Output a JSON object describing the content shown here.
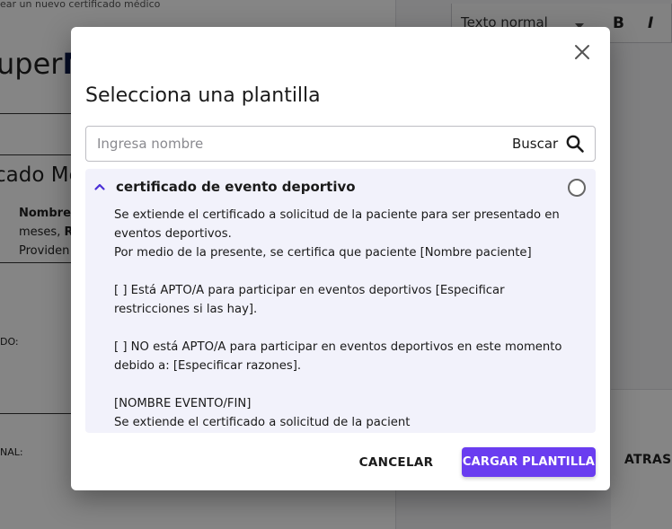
{
  "background": {
    "breadcrumb": "ear un nuevo certificado médico",
    "logo_light": "uper",
    "logo_bold": "M",
    "section_title": "cado Mé",
    "patient_name_label": "Nombre:",
    "patient_line2_a": "meses, ",
    "patient_line2_b": "R",
    "patient_line3": "Providen",
    "label_1": "DO:",
    "label_2": "NAL:",
    "editor_style_select": "Texto normal",
    "bold_tool": "B",
    "italic_tool": "I",
    "back_button": "ATRAS"
  },
  "modal": {
    "title": "Selecciona una plantilla",
    "close_icon": "close-icon",
    "search": {
      "placeholder": "Ingresa nombre",
      "value": "",
      "button_label": "Buscar",
      "icon": "search-icon"
    },
    "templates": [
      {
        "title": "certificado de evento deportivo",
        "expanded": true,
        "selected": false,
        "body_lines": [
          "Se extiende el certificado a solicitud de la paciente para ser presentado en eventos deportivos.",
          "Por medio de la presente, se certifica que paciente [Nombre paciente]",
          "",
          "[ ] Está APTO/A para participar en eventos deportivos [Especificar restricciones si las hay].",
          "",
          "[ ] NO está APTO/A para participar en eventos deportivos en este momento debido a: [Especificar razones].",
          "",
          "[NOMBRE EVENTO/FIN]",
          "Se extiende el certificado a solicitud de la pacient"
        ]
      }
    ],
    "cancel_label": "CANCELAR",
    "load_label": "CARGAR PLANTILLA"
  },
  "colors": {
    "primary": "#6a3df0",
    "card_background": "#f2f2fb",
    "overlay": "rgba(0,0,0,0.48)"
  }
}
